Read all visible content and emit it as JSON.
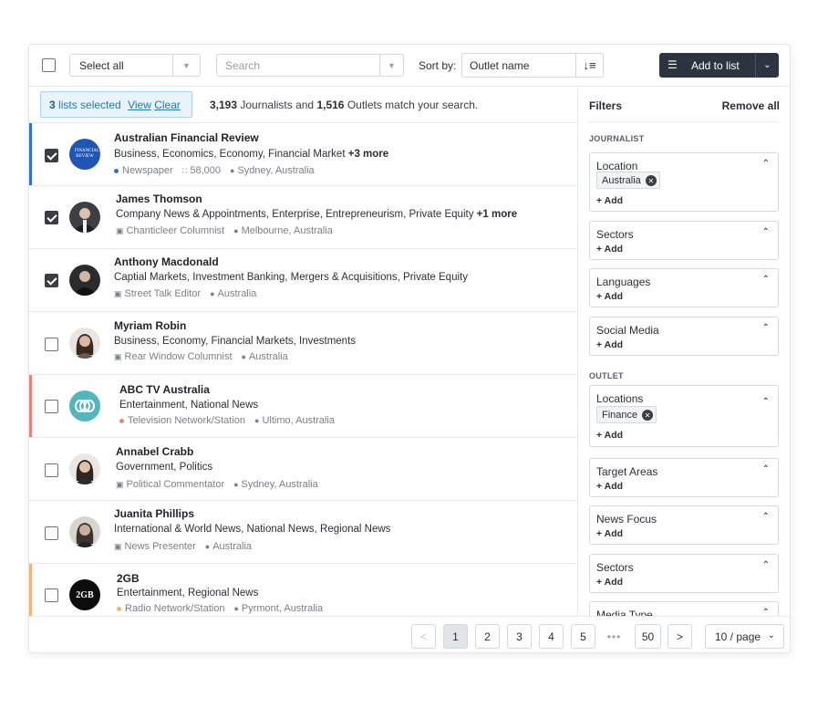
{
  "toolbar": {
    "select_all_label": "Select all",
    "search_placeholder": "Search",
    "sort_by_label": "Sort by:",
    "sort_value": "Outlet name",
    "add_to_list_label": "Add to list"
  },
  "info": {
    "lists_selected_count": "3",
    "lists_selected_label": "lists selected",
    "view_label": "View",
    "clear_label": "Clear",
    "journalists_count": "3,193",
    "journalists_label": "Journalists and",
    "outlets_count": "1,516",
    "outlets_label": "Outlets match your search."
  },
  "rows": [
    {
      "name": "Australian Financial Review",
      "topics": "Business, Economics, Economy, Financial Market",
      "more": "+3 more",
      "meta1": "Newspaper",
      "meta2": "58,000",
      "location": "Sydney, Australia",
      "checked": true
    },
    {
      "name": "James Thomson",
      "topics": "Company News & Appointments, Enterprise, Entrepreneurism, Private Equity",
      "more": "+1 more",
      "meta1": "Chanticleer Columnist",
      "location": "Melbourne, Australia",
      "checked": true
    },
    {
      "name": "Anthony Macdonald",
      "topics": "Captial Markets, Investment Banking, Mergers & Acquisitions, Private Equity",
      "meta1": "Street Talk Editor",
      "location": "Australia",
      "checked": true
    },
    {
      "name": "Myriam Robin",
      "topics": "Business, Economy, Financial  Markets, Investments",
      "meta1": "Rear Window Columnist",
      "location": "Australia",
      "checked": false
    },
    {
      "name": "ABC TV Australia",
      "topics": "Entertainment, National News",
      "meta1": "Television Network/Station",
      "location": "Ultimo, Australia",
      "checked": false
    },
    {
      "name": "Annabel Crabb",
      "topics": "Government, Politics",
      "meta1": "Political Commentator",
      "location": "Sydney, Australia",
      "checked": false
    },
    {
      "name": "Juanita Phillips",
      "topics": "International & World News, National News, Regional News",
      "meta1": "News Presenter",
      "location": "Australia",
      "checked": false
    },
    {
      "name": "2GB",
      "topics": "Entertainment, Regional News",
      "meta1": "Radio Network/Station",
      "location": "Pyrmont, Australia",
      "checked": false
    }
  ],
  "afr_logo_text": "FINANCIAL REVIEW",
  "gb_logo_text": "2GB",
  "pagination": {
    "prev": "<",
    "pages": [
      "1",
      "2",
      "3",
      "4",
      "5"
    ],
    "ellipsis": "•••",
    "last": "50",
    "next": ">",
    "per_page": "10 / page"
  },
  "filters": {
    "title": "Filters",
    "remove_all": "Remove all",
    "journalist_section": "JOURNALIST",
    "outlet_section": "OUTLET",
    "add_label": "+ Add",
    "location_title": "Location",
    "location_chip": "Australia",
    "sectors_title": "Sectors",
    "languages_title": "Languages",
    "social_media_title": "Social Media",
    "locations_title": "Locations",
    "locations_chip": "Finance",
    "target_areas_title": "Target Areas",
    "news_focus_title": "News Focus",
    "outlet_sectors_title": "Sectors",
    "media_type_title": "Media Type"
  },
  "colors": {
    "afr_bar": "#2f6fd6",
    "abc_bar": "#e9827a",
    "gb_bar": "#f2b478",
    "afr_logo": "#1f56b5",
    "abc_logo": "#52b6ba",
    "primary_dark": "#2c3440",
    "link": "#1f7ab8"
  }
}
